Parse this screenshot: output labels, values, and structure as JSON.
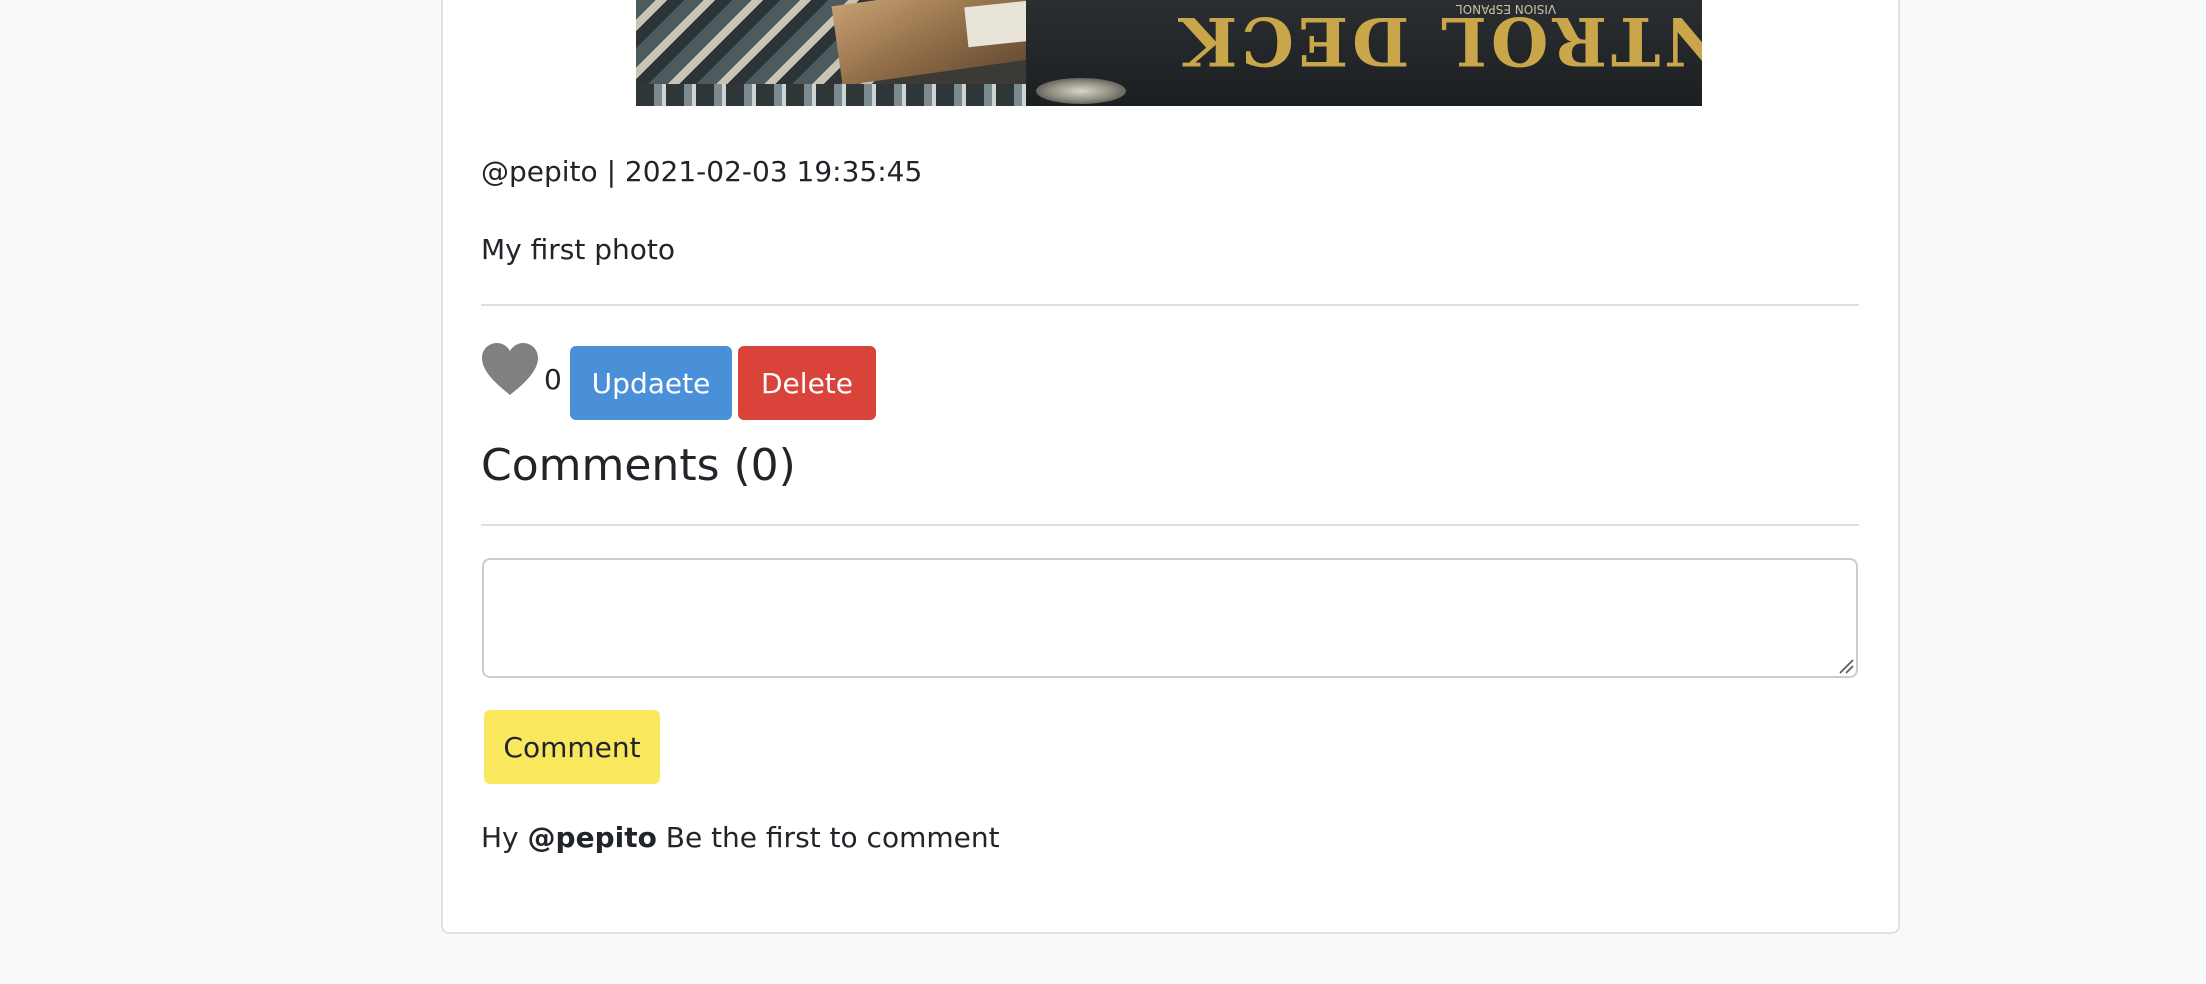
{
  "post": {
    "author": "@pepito",
    "separator": "|",
    "timestamp": "2021-02-03 19:35:45",
    "caption": "My first photo",
    "photo_text": "CONTROL DECK",
    "photo_small_text": "VISION ESPANOL"
  },
  "actions": {
    "like_icon": "heart-icon",
    "like_count": "0",
    "update_label": "Updaete",
    "delete_label": "Delete"
  },
  "comments": {
    "heading": "Comments (0)",
    "input_value": "",
    "input_placeholder": "",
    "submit_label": "Comment",
    "empty_prefix": "Hy",
    "empty_handle": "@pepito",
    "empty_message": "Be the first to comment"
  },
  "colors": {
    "update": "#4a90d9",
    "delete": "#d9433a",
    "comment": "#f9e85e",
    "heart": "#808080"
  }
}
